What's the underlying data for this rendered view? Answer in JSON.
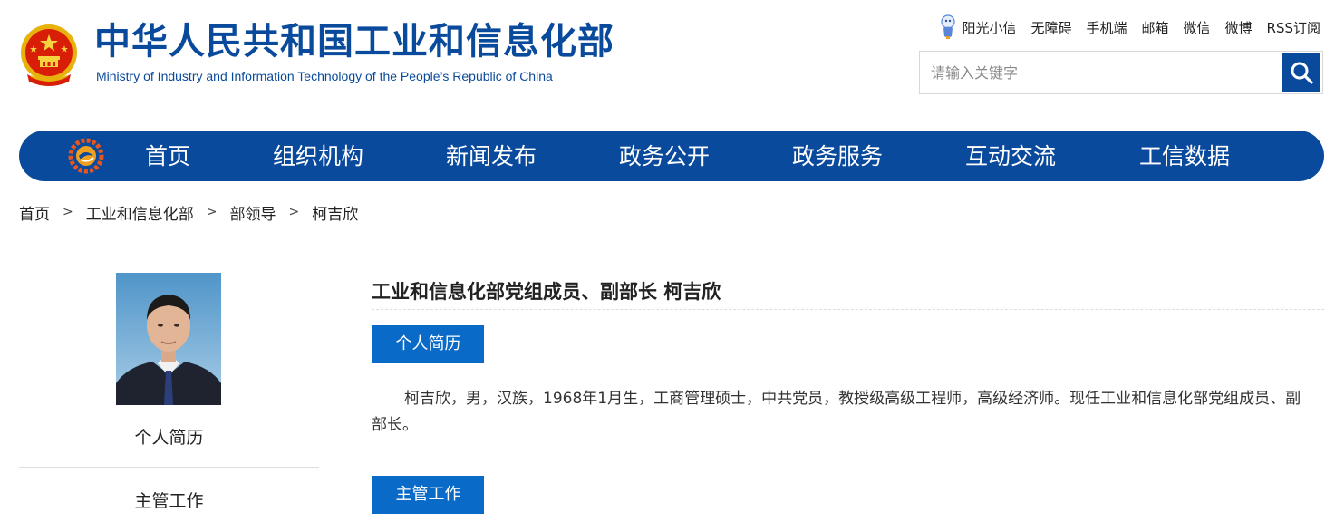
{
  "header": {
    "title": "中华人民共和国工业和信息化部",
    "subtitle": "Ministry of Industry and Information Technology of the People’s Republic of China",
    "top_links": [
      "阳光小信",
      "无障碍",
      "手机端",
      "邮箱",
      "微信",
      "微博",
      "RSS订阅"
    ],
    "search_placeholder": "请输入关键字"
  },
  "nav": {
    "items": [
      "首页",
      "组织机构",
      "新闻发布",
      "政务公开",
      "政务服务",
      "互动交流",
      "工信数据"
    ]
  },
  "breadcrumb": [
    "首页",
    "工业和信息化部",
    "部领导",
    "柯吉欣"
  ],
  "sidebar": {
    "items": [
      "个人简历",
      "主管工作"
    ]
  },
  "main": {
    "title": "工业和信息化部党组成员、副部长  柯吉欣",
    "section1_label": "个人简历",
    "bio": "柯吉欣，男，汉族，1968年1月生，工商管理硕士，中共党员，教授级高级工程师，高级经济师。现任工业和信息化部党组成员、副部长。",
    "section2_label": "主管工作"
  },
  "colors": {
    "brand_blue": "#0a4a9c",
    "tag_blue": "#0a6ac7"
  },
  "icons": {
    "emblem": "national-emblem-icon",
    "mascot": "sunshine-xiaoxin-icon",
    "search": "search-icon",
    "nav_logo": "miit-logo-icon"
  }
}
